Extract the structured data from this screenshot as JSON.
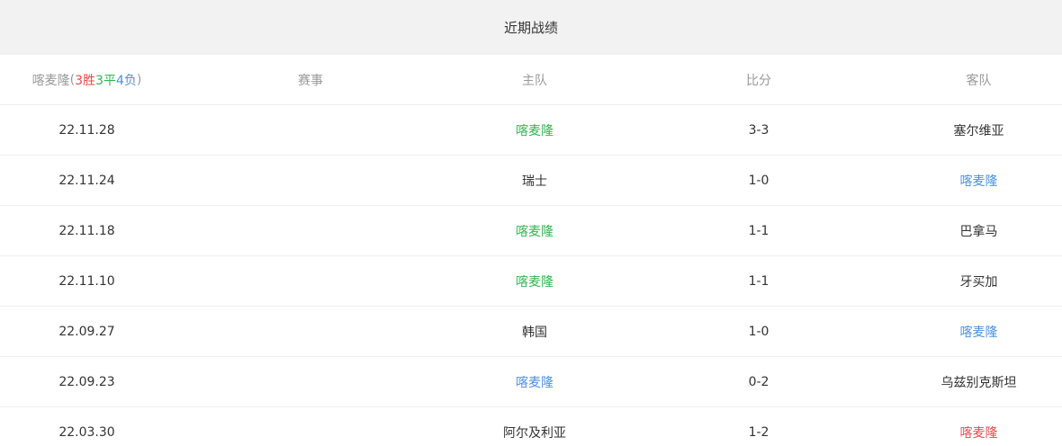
{
  "title": "近期战绩",
  "header": {
    "team": "喀麦隆",
    "paren_open": "(",
    "wins": "3胜",
    "draws": "3平",
    "losses": "4负",
    "paren_close": ")",
    "competition": "赛事",
    "home": "主队",
    "score": "比分",
    "away": "客队"
  },
  "colors": {
    "win": "#2fb550",
    "draw": "#4a90e2",
    "loss": "#e84a4a",
    "neutral": "#333333"
  },
  "rows": [
    {
      "date": "22.11.28",
      "competition": "",
      "home": "喀麦隆",
      "home_style": "green",
      "score": "3-3",
      "away": "塞尔维亚",
      "away_style": "black"
    },
    {
      "date": "22.11.24",
      "competition": "",
      "home": "瑞士",
      "home_style": "black",
      "score": "1-0",
      "away": "喀麦隆",
      "away_style": "blue"
    },
    {
      "date": "22.11.18",
      "competition": "",
      "home": "喀麦隆",
      "home_style": "green",
      "score": "1-1",
      "away": "巴拿马",
      "away_style": "black"
    },
    {
      "date": "22.11.10",
      "competition": "",
      "home": "喀麦隆",
      "home_style": "green",
      "score": "1-1",
      "away": "牙买加",
      "away_style": "black"
    },
    {
      "date": "22.09.27",
      "competition": "",
      "home": "韩国",
      "home_style": "black",
      "score": "1-0",
      "away": "喀麦隆",
      "away_style": "blue"
    },
    {
      "date": "22.09.23",
      "competition": "",
      "home": "喀麦隆",
      "home_style": "blue",
      "score": "0-2",
      "away": "乌兹别克斯坦",
      "away_style": "black"
    },
    {
      "date": "22.03.30",
      "competition": "",
      "home": "阿尔及利亚",
      "home_style": "black",
      "score": "1-2",
      "away": "喀麦隆",
      "away_style": "red"
    }
  ]
}
